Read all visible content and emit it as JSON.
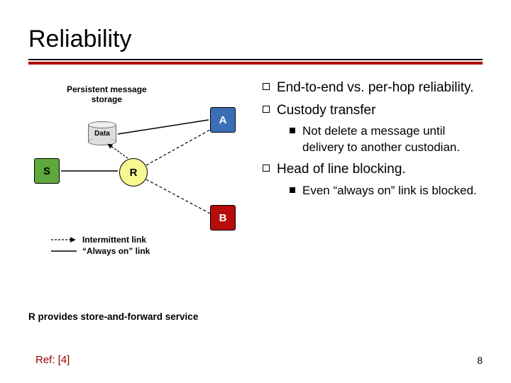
{
  "title": "Reliability",
  "diagram": {
    "storage_label_l1": "Persistent message",
    "storage_label_l2": "storage",
    "data_label": "Data",
    "node_s": "S",
    "node_r": "R",
    "node_a": "A",
    "node_b": "B",
    "legend_intermittent": "Intermittent link",
    "legend_always": "“Always on” link"
  },
  "footer": "R provides store-and-forward service",
  "bullets": {
    "b1": "End-to-end vs. per-hop reliability.",
    "b2": "Custody transfer",
    "b2_sub": "Not delete a message until delivery to another custodian.",
    "b3": "Head of line blocking.",
    "b3_sub": "Even “always on” link is blocked."
  },
  "ref": "Ref: [4]",
  "page": "8"
}
